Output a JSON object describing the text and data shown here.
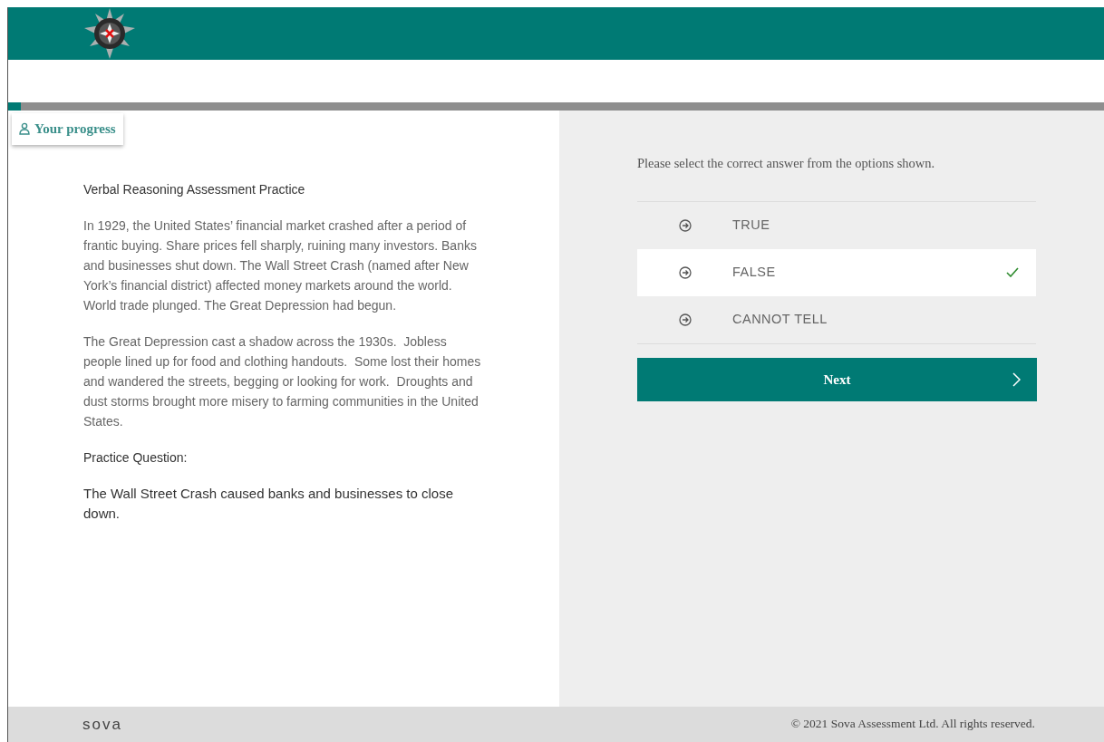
{
  "progress": {
    "label": "Your progress"
  },
  "passage": {
    "title": "Verbal Reasoning Assessment Practice",
    "paragraphs": [
      "In 1929, the United States’ financial market crashed after a period of frantic buying. Share prices fell sharply, ruining many investors. Banks and businesses shut down. The Wall Street Crash (named after New York’s financial district) affected money markets around the world. World trade plunged. The Great Depression had begun.",
      "The Great Depression cast a shadow across the 1930s.  Jobless people lined up for food and clothing handouts.  Some lost their homes and wandered the streets, begging or looking for work.  Droughts and dust storms brought more misery to farming communities in the United States."
    ],
    "question_label": "Practice Question:",
    "question": "The Wall Street Crash caused banks and businesses to close down."
  },
  "answers": {
    "instruction": "Please select the correct answer from the options shown.",
    "options": [
      {
        "label": "TRUE",
        "selected": false
      },
      {
        "label": "FALSE",
        "selected": true
      },
      {
        "label": "CANNOT TELL",
        "selected": false
      }
    ],
    "next_button": "Next"
  },
  "footer": {
    "logo": "sova",
    "copyright": "© 2021 Sova Assessment Ltd. All rights reserved."
  }
}
